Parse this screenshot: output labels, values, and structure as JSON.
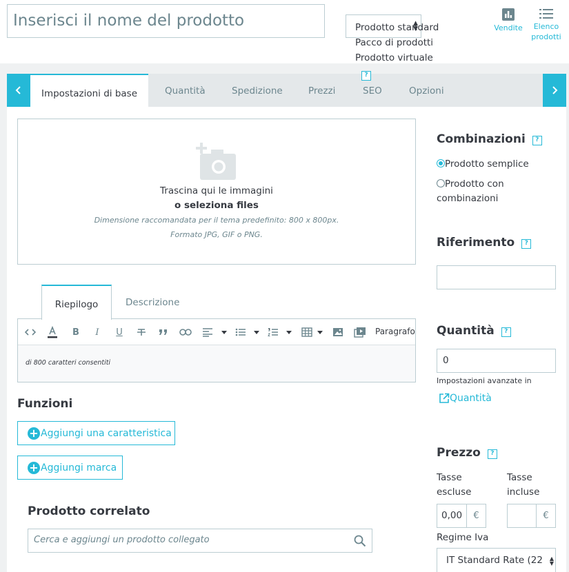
{
  "header": {
    "product_name_placeholder": "Inserisci il nome del prodotto",
    "type_options": [
      "Prodotto standard",
      "Pacco di prodotti",
      "Prodotto virtuale"
    ],
    "sales_label": "Vendite",
    "list_label_1": "Elenco",
    "list_label_2": "prodotti"
  },
  "tabs": [
    {
      "label": "Impostazioni di base"
    },
    {
      "label": "Quantità"
    },
    {
      "label": "Spedizione"
    },
    {
      "label": "Prezzi"
    },
    {
      "label": "SEO"
    },
    {
      "label": "Opzioni"
    }
  ],
  "help_mark": "?",
  "dropzone": {
    "line1": "Trascina qui le immagini",
    "line2": "o seleziona files",
    "line3": "Dimensione raccomandata per il tema predefinito: 800 x 800px.",
    "line4": "Formato JPG, GIF o PNG."
  },
  "description_tabs": {
    "summary": "Riepilogo",
    "description": "Descrizione"
  },
  "editor": {
    "paragraph_label": "Paragrafo",
    "char_counter": "di 800 caratteri consentiti"
  },
  "features": {
    "title": "Funzioni",
    "add_feature": "Aggiungi una caratteristica",
    "add_brand": "Aggiungi marca"
  },
  "related": {
    "title": "Prodotto correlato",
    "placeholder": "Cerca e aggiungi un prodotto collegato"
  },
  "combinations": {
    "title": "Combinazioni",
    "simple": "Prodotto semplice",
    "with_comb_1": "Prodotto con",
    "with_comb_2": "combinazioni"
  },
  "reference": {
    "title": "Riferimento",
    "value": ""
  },
  "quantity": {
    "title": "Quantità",
    "value": "0",
    "advanced_note": "Impostazioni avanzate in",
    "link": "Quantità"
  },
  "price": {
    "title": "Prezzo",
    "tax_excl_1": "Tasse",
    "tax_excl_2": "escluse",
    "tax_incl_1": "Tasse",
    "tax_incl_2": "incluse",
    "tax_excl_value": "0,00",
    "tax_incl_value": "",
    "currency": "€",
    "tax_rule_label": "Regime Iva",
    "tax_rule_value": "IT Standard Rate (22"
  },
  "colors": {
    "accent": "#25b9d7",
    "text": "#363a41",
    "muted": "#6c868e",
    "border": "#bbcdd2"
  }
}
